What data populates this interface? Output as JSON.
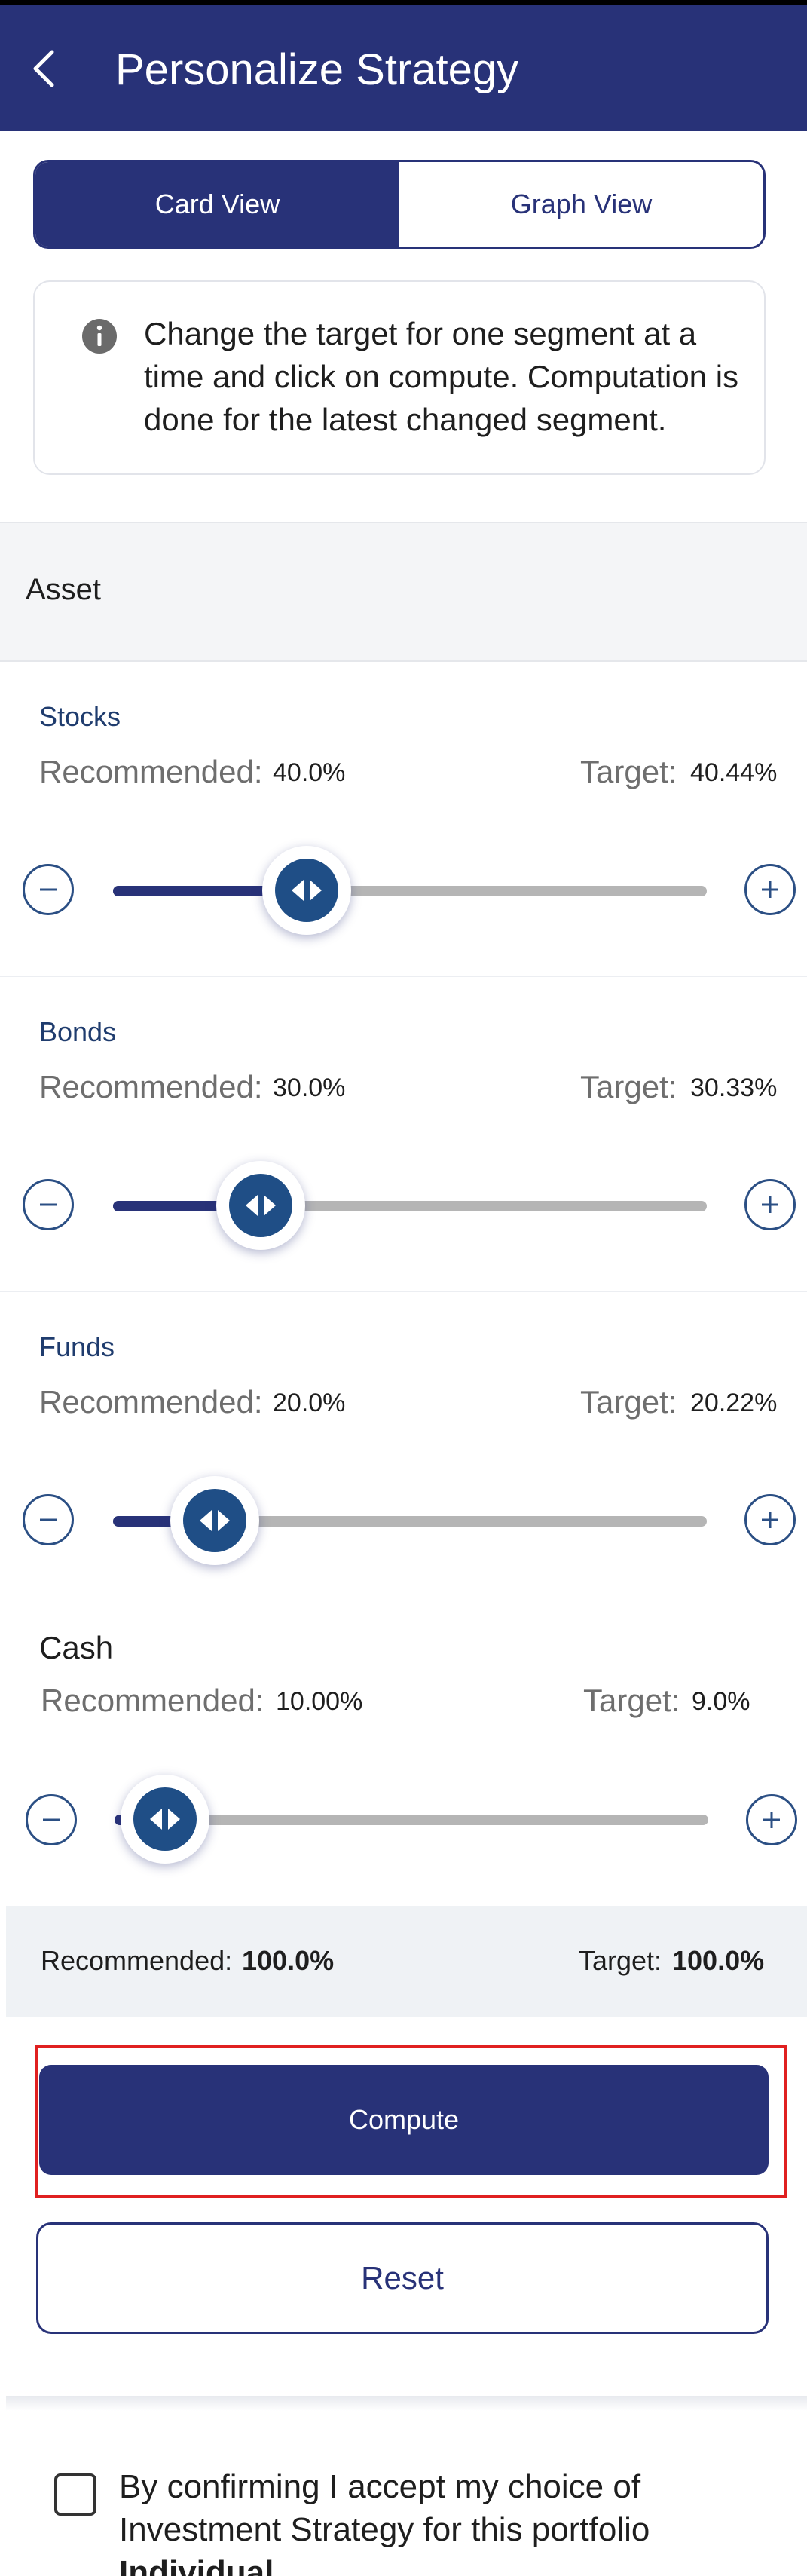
{
  "header": {
    "title": "Personalize Strategy",
    "back_icon": "chevron-left-icon"
  },
  "view_toggle": {
    "card_view": "Card View",
    "graph_view": "Graph View",
    "selected": "Card View"
  },
  "info_note": {
    "icon": "info-icon",
    "text": "Change the target for one segment at a time and click on compute. Computation is done for the latest changed segment."
  },
  "asset_header": "Asset",
  "segments": [
    {
      "name": "Stocks",
      "recommended_label": "Recommended:",
      "recommended": "40.0%",
      "target_label": "Target:",
      "target": "40.44%",
      "slider_value": 0.4044
    },
    {
      "name": "Bonds",
      "recommended_label": "Recommended:",
      "recommended": "30.0%",
      "target_label": "Target:",
      "target": "30.33%",
      "slider_value": 0.3033
    },
    {
      "name": "Funds",
      "recommended_label": "Recommended:",
      "recommended": "20.0%",
      "target_label": "Target:",
      "target": "20.22%",
      "slider_value": 0.2022
    },
    {
      "name": "Cash",
      "recommended_label": "Recommended:",
      "recommended": "10.00%",
      "target_label": "Target:",
      "target": "9.0%",
      "slider_value": 0.09
    }
  ],
  "summary": {
    "recommended_label": "Recommended:",
    "recommended": "100.0%",
    "target_label": "Target:",
    "target": "100.0%"
  },
  "actions": {
    "compute": "Compute",
    "reset": "Reset"
  },
  "confirm": {
    "text": "By confirming I accept my choice of Investment Strategy for this portfolio ",
    "portfolio": "Individual"
  },
  "colors": {
    "primary": "#283278",
    "knob": "#1f4e86",
    "track": "#b5b5b5",
    "highlight_outline": "#e02020"
  }
}
